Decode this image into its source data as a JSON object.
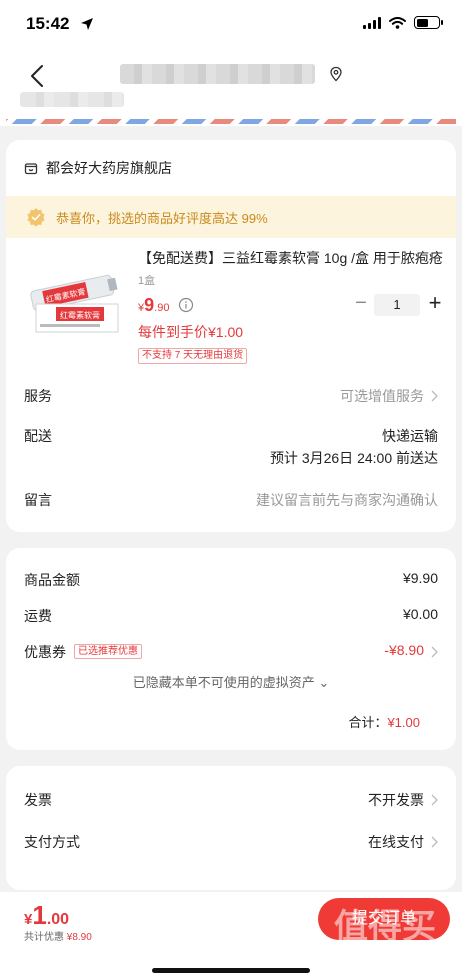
{
  "status_bar": {
    "time": "15:42"
  },
  "store": {
    "name": "都会好大药房旗舰店"
  },
  "praise": {
    "text": "恭喜你，挑选的商品好评度高达 99%"
  },
  "product": {
    "title": "【免配送费】三益红霉素软膏 10g /盒 用于脓疱疮",
    "spec": "1盒",
    "price_symbol": "¥",
    "price_int": "9",
    "price_dec": ".90",
    "quantity": "1",
    "qty_minus": "−",
    "qty_plus": "+",
    "hand_price": "每件到手价¥1.00",
    "no_return": "不支持 7 天无理由退货",
    "image_label_top": "红霉素软膏",
    "image_label_box": "红霉素软膏"
  },
  "rows": {
    "service_label": "服务",
    "service_value": "可选增值服务",
    "delivery_label": "配送",
    "delivery_value": "快递运输",
    "delivery_eta": "预计 3月26日 24:00 前送达",
    "message_label": "留言",
    "message_placeholder": "建议留言前先与商家沟通确认"
  },
  "summary": {
    "goods_label": "商品金额",
    "goods_value": "¥9.90",
    "shipping_label": "运费",
    "shipping_value": "¥0.00",
    "coupon_label": "优惠券",
    "coupon_badge": "已选推荐优惠",
    "coupon_value": "-¥8.90",
    "hidden_note": "已隐藏本单不可使用的虚拟资产 ⌄",
    "total_label": "合计：",
    "total_value": "¥1.00"
  },
  "invoice": {
    "invoice_label": "发票",
    "invoice_value": "不开发票",
    "payment_label": "支付方式",
    "payment_value": "在线支付"
  },
  "bottom": {
    "price_symbol": "¥",
    "price_int": "1",
    "price_dec": ".00",
    "discount_prefix": "共计优惠 ",
    "discount_value": "¥8.90",
    "submit_label": "提交订单",
    "watermark_text": "值得买",
    "watermark_url": "zhizhizhi.com"
  },
  "colors": {
    "accent": "#e4393c",
    "praise_bg": "#fdf4de",
    "praise_text": "#c98a1c",
    "page_bg": "#f2f2f2"
  }
}
